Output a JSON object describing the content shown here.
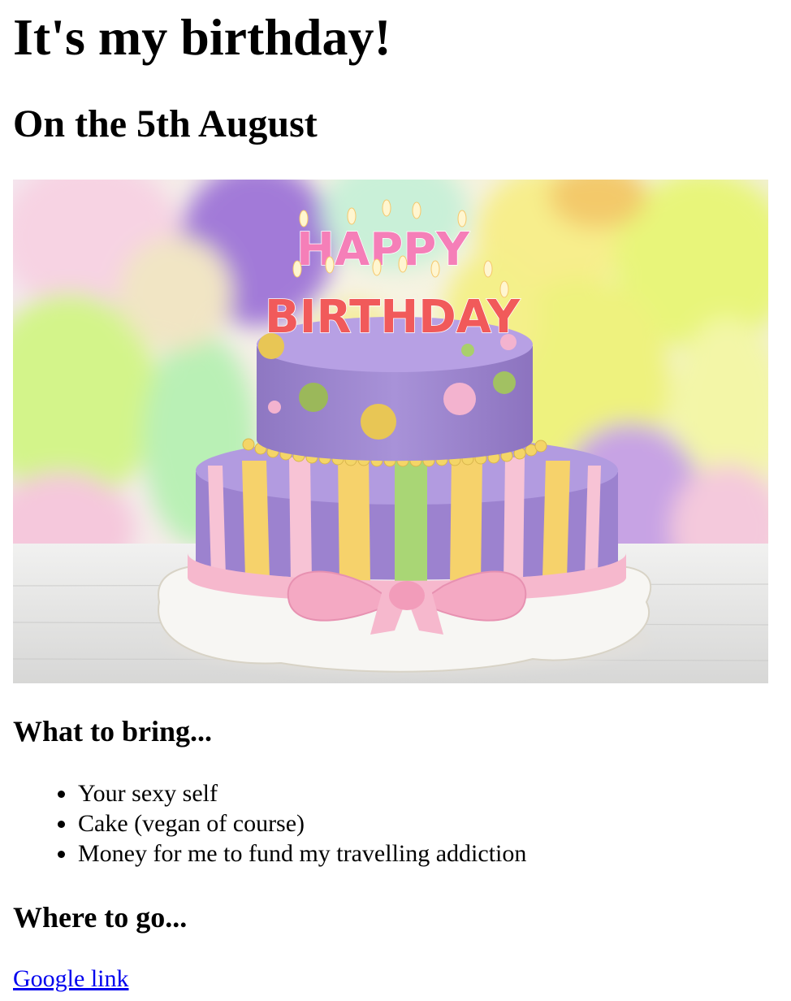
{
  "heading": "It's my birthday!",
  "subheading": "On the 5th August",
  "image": {
    "candles_top": "HAPPY",
    "candles_bottom": "BIRTHDAY",
    "icon": "birthday-cake-image"
  },
  "bring": {
    "title": "What to bring...",
    "items": [
      "Your sexy self",
      "Cake (vegan of course)",
      "Money for me to fund my travelling addiction"
    ]
  },
  "where": {
    "title": "Where to go...",
    "link_label": "Google link"
  },
  "colors": {
    "link": "#0000ee",
    "text": "#000000",
    "background": "#ffffff"
  }
}
